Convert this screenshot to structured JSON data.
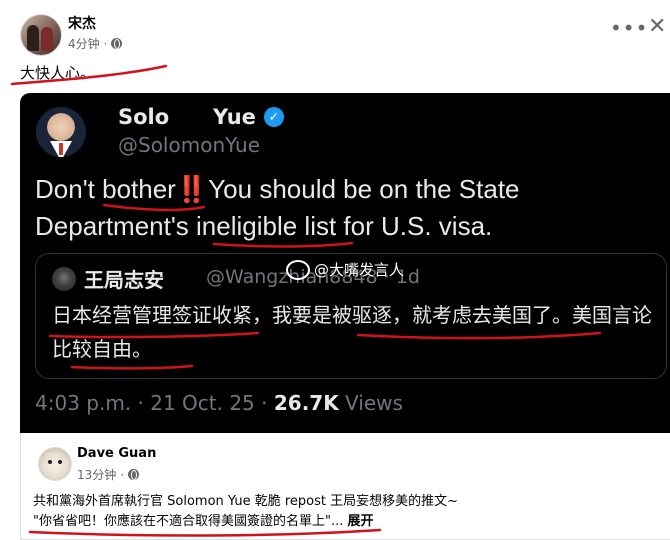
{
  "post": {
    "author": "宋杰",
    "time": "4分钟",
    "text": "大快人心。",
    "more_icon": "more-horizontal-icon",
    "close_icon": "close-icon"
  },
  "tweet": {
    "name": "Solo      Yue",
    "handle": "@SolomonYue",
    "text_before": "Don't bother",
    "bang": "‼️",
    "text_after": "You should be on the State Department's ineligible list for U.S. visa.",
    "quote": {
      "name": "王局志安",
      "handle": "@Wangzhian8848 · 1d",
      "text": "日本经营管理签证收紧，我要是被驱逐，就考虑去美国了。美国言论比较自由。"
    },
    "timestamp": "4:03 p.m. · 21 Oct. 25 · ",
    "views_count": "26.7K",
    "views_label": " Views",
    "watermark": "@大嘴发言人"
  },
  "comment": {
    "author": "Dave Guan",
    "time": "13分钟",
    "line1": "共和黨海外首席執行官 Solomon Yue 乾脆 repost 王局妄想移美的推文~",
    "line2": "\"你省省吧！你應該在不適合取得美國簽證的名單上\"...",
    "expand": "展开"
  },
  "colors": {
    "annotation_red": "#d0121b",
    "verified_blue": "#1d9bf0",
    "tweet_bg": "#000000"
  }
}
